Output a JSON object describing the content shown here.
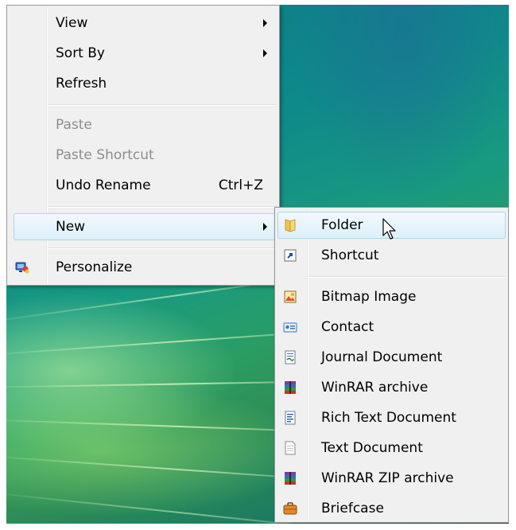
{
  "context_menu": {
    "items": [
      {
        "label": "View"
      },
      {
        "label": "Sort By"
      },
      {
        "label": "Refresh"
      },
      {
        "label": "Paste"
      },
      {
        "label": "Paste Shortcut"
      },
      {
        "label": "Undo Rename",
        "shortcut": "Ctrl+Z"
      },
      {
        "label": "New"
      },
      {
        "label": "Personalize"
      }
    ]
  },
  "new_submenu": {
    "items": [
      {
        "label": "Folder",
        "icon": "folder-icon"
      },
      {
        "label": "Shortcut",
        "icon": "shortcut-icon"
      },
      {
        "label": "Bitmap Image",
        "icon": "bitmap-image-icon"
      },
      {
        "label": "Contact",
        "icon": "contact-icon"
      },
      {
        "label": "Journal Document",
        "icon": "journal-document-icon"
      },
      {
        "label": "WinRAR archive",
        "icon": "winrar-archive-icon"
      },
      {
        "label": "Rich Text Document",
        "icon": "rich-text-document-icon"
      },
      {
        "label": "Text Document",
        "icon": "text-document-icon"
      },
      {
        "label": "WinRAR ZIP archive",
        "icon": "winrar-zip-icon"
      },
      {
        "label": "Briefcase",
        "icon": "briefcase-icon"
      }
    ]
  },
  "colors": {
    "hover_border": "#a8d8eb",
    "disabled_text": "#8d8d8d",
    "menu_background": "#f0f0f0"
  }
}
